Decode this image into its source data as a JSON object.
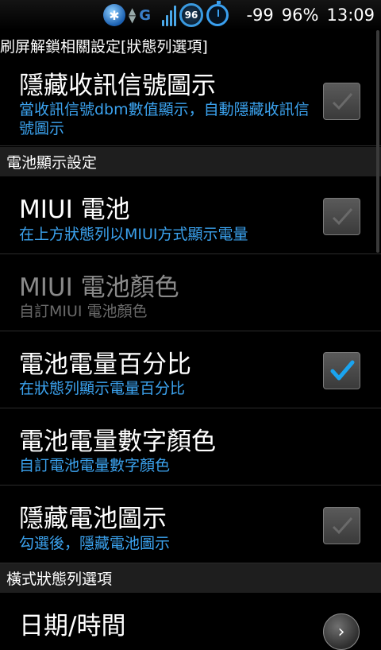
{
  "statusbar": {
    "network_type": "G",
    "notification_count": "96",
    "signal": "-99",
    "battery": "96%",
    "time": "13:09"
  },
  "sections": {
    "top_header": "刷屏解鎖相關設定[狀態列選項]",
    "battery_header": "電池顯示設定",
    "landscape_header": "橫式狀態列選項"
  },
  "items": [
    {
      "title": "隱藏收訊信號圖示",
      "summary": "當收訊信號dbm數值顯示，自動隱藏收訊信號圖示",
      "checked": false
    },
    {
      "title": "MIUI 電池",
      "summary": "在上方狀態列以MIUI方式顯示電量",
      "checked": false
    },
    {
      "title": "MIUI 電池顏色",
      "summary": "自訂MIUI 電池顏色",
      "enabled": false
    },
    {
      "title": "電池電量百分比",
      "summary": "在狀態列顯示電量百分比",
      "checked": true
    },
    {
      "title": "電池電量數字顏色",
      "summary": "自訂電池電量數字顏色"
    },
    {
      "title": "隱藏電池圖示",
      "summary": "勾選後，隱藏電池圖示",
      "checked": false
    },
    {
      "title": "日期/時間"
    }
  ],
  "colors": {
    "summary_blue": "#3ba2ee",
    "check_blue": "#1aa4f0",
    "header_bg": "#1e1e1e"
  }
}
